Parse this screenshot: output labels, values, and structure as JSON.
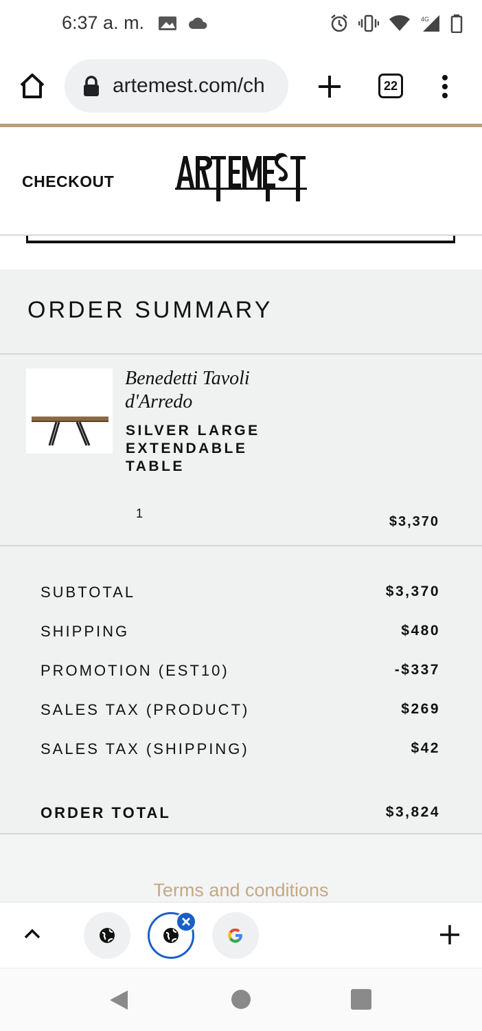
{
  "status_bar": {
    "time": "6:37 a. m.",
    "network_label": "4G"
  },
  "browser": {
    "url": "artemest.com/ch",
    "tab_count": "22"
  },
  "header": {
    "checkout_label": "CHECKOUT",
    "logo_text": "ARTEMEST"
  },
  "summary": {
    "title": "ORDER SUMMARY",
    "item": {
      "brand": "Benedetti Tavoli d'Arredo",
      "name": "SILVER LARGE EXTENDABLE TABLE",
      "quantity": "1",
      "price": "$3,370"
    },
    "lines": [
      {
        "label": "SUBTOTAL",
        "value": "$3,370"
      },
      {
        "label": "SHIPPING",
        "value": "$480"
      },
      {
        "label": "PROMOTION (EST10)",
        "value": "-$337"
      },
      {
        "label": "SALES TAX (PRODUCT)",
        "value": "$269"
      },
      {
        "label": "SALES TAX (SHIPPING)",
        "value": "$42"
      }
    ],
    "total": {
      "label": "ORDER TOTAL",
      "value": "$3,824"
    },
    "terms_link": "Terms and conditions"
  },
  "tab_strip": {
    "tabs": [
      {
        "icon": "globe-icon",
        "active": false
      },
      {
        "icon": "globe-icon",
        "active": true
      },
      {
        "icon": "google-icon",
        "active": false
      }
    ]
  },
  "colors": {
    "accent_gold": "#b89f72",
    "terms_link": "#c6a882",
    "summary_bg": "#f0f1f1",
    "active_tab_blue": "#1a5fc4"
  }
}
